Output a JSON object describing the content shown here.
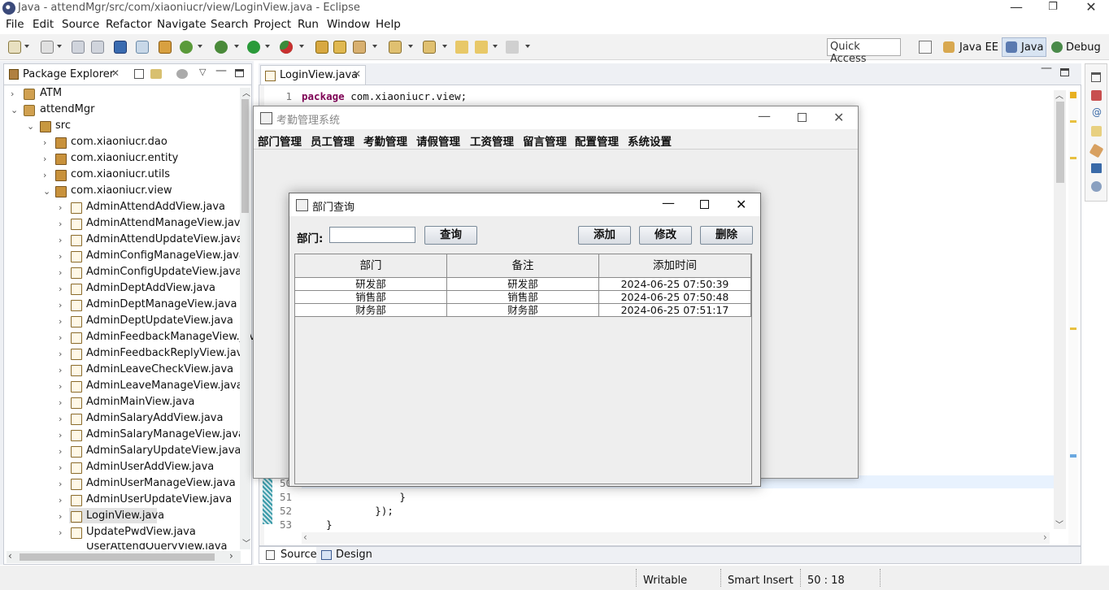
{
  "window": {
    "title": "Java - attendMgr/src/com/xiaoniucr/view/LoginView.java - Eclipse"
  },
  "menu": [
    "File",
    "Edit",
    "Source",
    "Refactor",
    "Navigate",
    "Search",
    "Project",
    "Run",
    "Window",
    "Help"
  ],
  "toolbar": {
    "quick_access": "Quick Access",
    "perspectives": [
      "Java EE",
      "Java",
      "Debug"
    ]
  },
  "package_explorer": {
    "title": "Package Explorer",
    "projects": {
      "atm": "ATM",
      "attend": "attendMgr",
      "src": "src"
    },
    "packages": [
      "com.xiaoniucr.dao",
      "com.xiaoniucr.entity",
      "com.xiaoniucr.utils",
      "com.xiaoniucr.view"
    ],
    "files": [
      "AdminAttendAddView.java",
      "AdminAttendManageView.java",
      "AdminAttendUpdateView.java",
      "AdminConfigManageView.java",
      "AdminConfigUpdateView.java",
      "AdminDeptAddView.java",
      "AdminDeptManageView.java",
      "AdminDeptUpdateView.java",
      "AdminFeedbackManageView.jav",
      "AdminFeedbackReplyView.java",
      "AdminLeaveCheckView.java",
      "AdminLeaveManageView.java",
      "AdminMainView.java",
      "AdminSalaryAddView.java",
      "AdminSalaryManageView.java",
      "AdminSalaryUpdateView.java",
      "AdminUserAddView.java",
      "AdminUserManageView.java",
      "AdminUserUpdateView.java",
      "LoginView.java",
      "UpdatePwdView.java",
      "UserAttendQueryView.java"
    ]
  },
  "editor": {
    "tab": "LoginView.java",
    "line1_no": "1",
    "line1_kw": "package",
    "line1_rest": " com.xiaoniucr.view;",
    "lines": [
      {
        "no": "50",
        "code": ""
      },
      {
        "no": "51",
        "code": "                }"
      },
      {
        "no": "52",
        "code": "            });"
      },
      {
        "no": "53",
        "code": "    }"
      }
    ],
    "bottom_tabs": {
      "source": "Source",
      "design": "Design"
    }
  },
  "status": {
    "writable": "Writable",
    "insert": "Smart Insert",
    "position": "50 : 18"
  },
  "app_window": {
    "title": "考勤管理系统",
    "menu": [
      "部门管理",
      "员工管理",
      "考勤管理",
      "请假管理",
      "工资管理",
      "留言管理",
      "配置管理",
      "系统设置"
    ]
  },
  "dialog": {
    "title": "部门查询",
    "dept_label": "部门:",
    "search_value": "",
    "buttons": {
      "query": "查询",
      "add": "添加",
      "edit": "修改",
      "delete": "删除"
    },
    "table": {
      "headers": [
        "部门",
        "备注",
        "添加时间"
      ],
      "rows": [
        [
          "研发部",
          "研发部",
          "2024-06-25 07:50:39"
        ],
        [
          "销售部",
          "销售部",
          "2024-06-25 07:50:48"
        ],
        [
          "财务部",
          "财务部",
          "2024-06-25 07:51:17"
        ]
      ]
    }
  }
}
